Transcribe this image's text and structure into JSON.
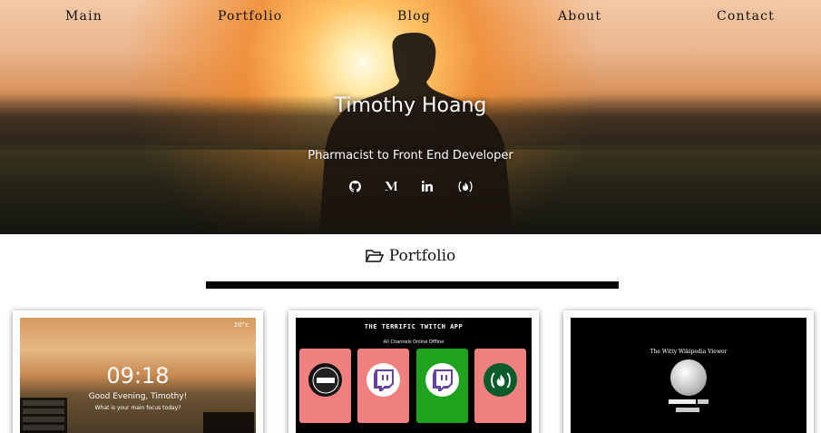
{
  "nav": {
    "items": [
      "Main",
      "Portfolio",
      "Blog",
      "About",
      "Contact"
    ]
  },
  "hero": {
    "title": "Timothy Hoang",
    "subtitle": "Pharmacist to Front End Developer",
    "social_icons": [
      "github-icon",
      "medium-icon",
      "linkedin-icon",
      "freecodecamp-icon"
    ]
  },
  "portfolio": {
    "heading": "Portfolio",
    "heading_icon": "folder-open-icon",
    "projects": [
      {
        "name": "momentum",
        "time": "09:18",
        "greeting": "Good Evening, Timothy!",
        "focus_prompt": "What is your main focus today?",
        "temperature": "20°c"
      },
      {
        "name": "twitch",
        "title": "THE TERRIFIC TWITCH APP",
        "tabs": "All Channels  Online  Offline",
        "tiles": [
          {
            "color": "#f08080",
            "logo": "esl"
          },
          {
            "color": "#f08080",
            "logo": "twitch"
          },
          {
            "color": "#1fa31f",
            "logo": "twitch"
          },
          {
            "color": "#f08080",
            "logo": "freecodecamp"
          }
        ]
      },
      {
        "name": "wikipedia",
        "title": "The Witty Wikipedia Viewer"
      }
    ]
  },
  "colors": {
    "nav_text": "#111111",
    "hero_text": "#ffffff",
    "divider": "#000000",
    "twitch_online": "#1fa31f",
    "twitch_offline": "#f08080",
    "twitch_purple": "#6441a4"
  }
}
